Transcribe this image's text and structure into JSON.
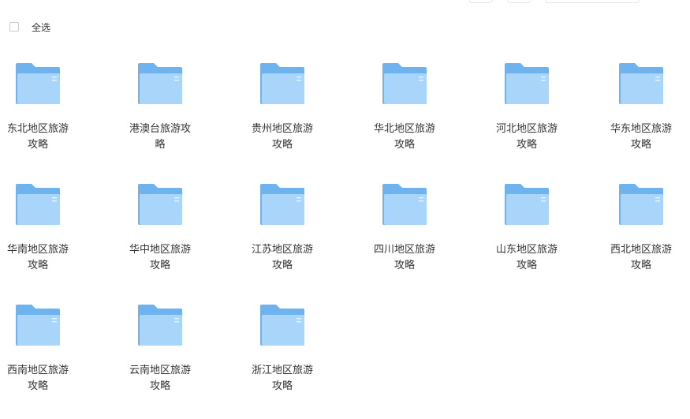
{
  "select_all": {
    "label": "全选"
  },
  "folders": [
    {
      "name": "东北地区旅游攻略"
    },
    {
      "name": "港澳台旅游攻略"
    },
    {
      "name": "贵州地区旅游攻略"
    },
    {
      "name": "华北地区旅游攻略"
    },
    {
      "name": "河北地区旅游攻略"
    },
    {
      "name": "华东地区旅游攻略"
    },
    {
      "name": "华南地区旅游攻略"
    },
    {
      "name": "华中地区旅游攻略"
    },
    {
      "name": "江苏地区旅游攻略"
    },
    {
      "name": "四川地区旅游攻略"
    },
    {
      "name": "山东地区旅游攻略"
    },
    {
      "name": "西北地区旅游攻略"
    },
    {
      "name": "西南地区旅游攻略"
    },
    {
      "name": "云南地区旅游攻略"
    },
    {
      "name": "浙江地区旅游攻略"
    }
  ],
  "colors": {
    "folder_back": "#6fb3ee",
    "folder_front": "#a9d5fb",
    "text": "#333333"
  },
  "icons": {
    "folder": "folder-icon",
    "checkbox": "checkbox-icon"
  }
}
